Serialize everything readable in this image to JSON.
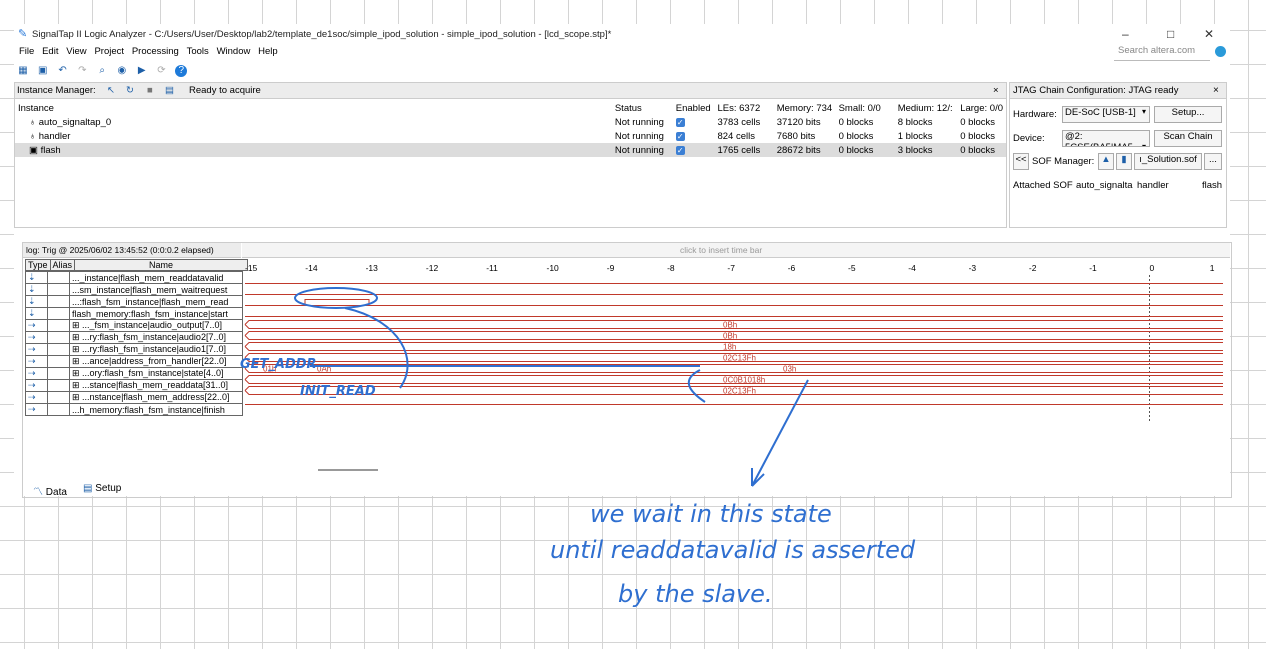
{
  "window": {
    "title": "SignalTap II Logic Analyzer - C:/Users/User/Desktop/lab2/template_de1soc/simple_ipod_solution - simple_ipod_solution - [lcd_scope.stp]*",
    "min": "–",
    "max": "□",
    "close": "✕"
  },
  "menu": [
    "File",
    "Edit",
    "View",
    "Project",
    "Processing",
    "Tools",
    "Window",
    "Help"
  ],
  "search_placeholder": "Search altera.com",
  "instance_manager": {
    "label": "Instance Manager:",
    "status": "Ready to acquire",
    "close": "×",
    "headers": [
      "Instance",
      "Status",
      "Enabled",
      "LEs: 6372",
      "Memory: 734",
      "Small: 0/0",
      "Medium: 12/:",
      "Large: 0/0"
    ],
    "rows": [
      {
        "name": "auto_signaltap_0",
        "status": "Not running",
        "les": "3783 cells",
        "mem": "37120 bits",
        "small": "0 blocks",
        "medium": "8 blocks",
        "large": "0 blocks"
      },
      {
        "name": "handler",
        "status": "Not running",
        "les": "824 cells",
        "mem": "7680 bits",
        "small": "0 blocks",
        "medium": "1 blocks",
        "large": "0 blocks"
      },
      {
        "name": "flash",
        "status": "Not running",
        "les": "1765 cells",
        "mem": "28672 bits",
        "small": "0 blocks",
        "medium": "3 blocks",
        "large": "0 blocks"
      }
    ]
  },
  "jtag": {
    "title": "JTAG Chain Configuration:  JTAG ready",
    "close": "×",
    "hardware_label": "Hardware:",
    "hardware": "DE-SoC [USB-1]",
    "setup": "Setup...",
    "device_label": "Device:",
    "device": "@2: 5CSE(BA5|MA5",
    "scan": "Scan Chain",
    "sof_prev": "<<",
    "sof_label": "SOF Manager:",
    "sof_file": "ı_Solution.sof",
    "sof_more": "...",
    "attached": "Attached SOF",
    "col1": "auto_signalta",
    "col2": "handler",
    "col3": "flash"
  },
  "waveform": {
    "log": "log: Trig @ 2025/06/02 13:45:52 (0:0:0.2 elapsed)",
    "insert": "click to insert time bar",
    "col_type": "Type",
    "col_alias": "Alias",
    "col_name": "Name",
    "ticks": [
      "-15",
      "-14",
      "-13",
      "-12",
      "-11",
      "-10",
      "-9",
      "-8",
      "-7",
      "-6",
      "-5",
      "-4",
      "-3",
      "-2",
      "-1",
      "0",
      "1"
    ],
    "signals": [
      {
        "name": "..._instance|flash_mem_readdatavalid",
        "value": ""
      },
      {
        "name": "...sm_instance|flash_mem_waitrequest",
        "value": ""
      },
      {
        "name": "...:flash_fsm_instance|flash_mem_read",
        "value": ""
      },
      {
        "name": "flash_memory:flash_fsm_instance|start",
        "value": ""
      },
      {
        "name": "⊞ ..._fsm_instance|audio_output[7..0]",
        "value": "0Bh"
      },
      {
        "name": "⊞ ...ry:flash_fsm_instance|audio2[7..0]",
        "value": "0Bh"
      },
      {
        "name": "⊞ ...ry:flash_fsm_instance|audio1[7..0]",
        "value": "18h"
      },
      {
        "name": "⊞ ...ance|address_from_handler[22..0]",
        "value": "02C13Fh"
      },
      {
        "name": "⊞ ...ory:flash_fsm_instance|state[4..0]",
        "value": "03h",
        "v1": "01h",
        "v2": "0Ah"
      },
      {
        "name": "⊞ ...stance|flash_mem_readdata[31..0]",
        "value": "0C0B1018h"
      },
      {
        "name": "⊞ ...nstance|flash_mem_address[22..0]",
        "value": "02C13Fh"
      },
      {
        "name": "...h_memory:flash_fsm_instance|finish",
        "value": ""
      }
    ],
    "tab_data": "Data",
    "tab_setup": "Setup"
  },
  "annotations": {
    "get_addr": "GET_ADDR",
    "init_read": "INIT_READ",
    "note_l1": "we wait in this state",
    "note_l2": "until readdatavalid is asserted",
    "note_l3": "by the slave."
  }
}
